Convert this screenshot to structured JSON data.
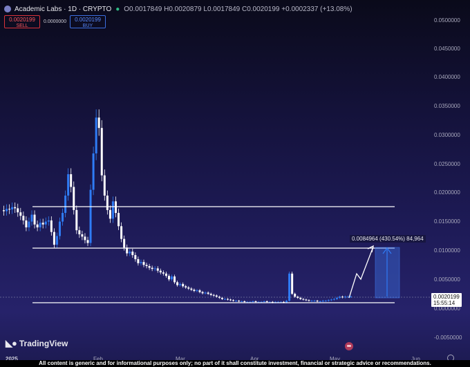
{
  "header": {
    "symbol": "Academic Labs · 1D · CRYPTO",
    "ohlc": "O0.0017849 H0.0020879 L0.0017849 C0.0020199 +0.0002337 (+13.08%)"
  },
  "trade": {
    "sell_price": "0.0020199",
    "sell_label": "SELL",
    "spread": "0.0000000",
    "buy_price": "0.0020199",
    "buy_label": "BUY"
  },
  "yaxis": {
    "ticks": [
      "0.0500000",
      "0.0450000",
      "0.0400000",
      "0.0350000",
      "0.0300000",
      "0.0250000",
      "0.0200000",
      "0.0150000",
      "0.0100000",
      "0.0050000",
      "0.0000000",
      "-0.0050000"
    ],
    "current_price": "0.0020199",
    "countdown": "15:55:14"
  },
  "xaxis": {
    "ticks": [
      "2025",
      "Feb",
      "Mar",
      "Apr",
      "May",
      "Jun"
    ]
  },
  "projection": {
    "label": "0.0084964 (430.54%) 84,964"
  },
  "levels": {
    "resistance_upper": 0.0175,
    "resistance_lower": 0.0105,
    "support": -0.0008
  },
  "branding": {
    "name": "TradingView"
  },
  "disclaimer": "All content is generic and for informational purposes only; no part of it shall constitute investment, financial or strategic advice or recommendations.",
  "colors": {
    "up": "#2f7cf6",
    "down": "#ffffff",
    "sell": "#d9323a",
    "buy": "#3b6fe0",
    "background": "#1d1a55"
  },
  "chart_data": {
    "type": "candlestick",
    "x": [
      "Jan 1",
      "Jan 2",
      "Jan 3",
      "Jan 4",
      "Jan 5",
      "Jan 6",
      "Jan 7",
      "Jan 8",
      "Jan 9",
      "Jan 10",
      "Jan 11",
      "Jan 12",
      "Jan 13",
      "Jan 14",
      "Jan 15",
      "Jan 16",
      "Jan 17",
      "Jan 18",
      "Jan 19",
      "Jan 20",
      "Jan 21",
      "Jan 22",
      "Jan 23",
      "Jan 24",
      "Jan 25",
      "Jan 26",
      "Jan 27",
      "Jan 28",
      "Jan 29",
      "Jan 30",
      "Jan 31",
      "Feb 1",
      "Feb 2",
      "Feb 3",
      "Feb 4",
      "Feb 5",
      "Feb 6",
      "Feb 7",
      "Feb 8",
      "Feb 9",
      "Feb 10",
      "Feb 11",
      "Feb 12",
      "Feb 13",
      "Feb 14",
      "Feb 15",
      "Feb 16",
      "Feb 17",
      "Feb 18",
      "Feb 19",
      "Feb 20",
      "Feb 21",
      "Feb 22",
      "Feb 23",
      "Feb 24",
      "Feb 25",
      "Feb 26",
      "Feb 27",
      "Feb 28",
      "Mar 1",
      "Mar 2",
      "Mar 3",
      "Mar 4",
      "Mar 5",
      "Mar 6",
      "Mar 7",
      "Mar 8",
      "Mar 9",
      "Mar 10",
      "Mar 11",
      "Mar 12",
      "Mar 13",
      "Mar 14",
      "Mar 15",
      "Mar 16",
      "Mar 17",
      "Mar 18",
      "Mar 19",
      "Mar 20",
      "Mar 21",
      "Mar 22",
      "Mar 23",
      "Mar 24",
      "Mar 25",
      "Mar 26",
      "Mar 27",
      "Mar 28",
      "Mar 29",
      "Mar 30",
      "Mar 31",
      "Apr 1",
      "Apr 2",
      "Apr 3",
      "Apr 4",
      "Apr 5",
      "Apr 6",
      "Apr 7",
      "Apr 8",
      "Apr 9",
      "Apr 10",
      "Apr 11",
      "Apr 12",
      "Apr 13",
      "Apr 14",
      "Apr 15",
      "Apr 16",
      "Apr 17",
      "Apr 18",
      "Apr 19",
      "Apr 20",
      "Apr 21",
      "Apr 22",
      "Apr 23",
      "Apr 24",
      "Apr 25",
      "Apr 26",
      "Apr 27",
      "Apr 28",
      "Apr 29",
      "Apr 30",
      "May 1",
      "May 2",
      "May 3",
      "May 4",
      "May 5",
      "May 6"
    ],
    "close": [
      0.0168,
      0.0172,
      0.0171,
      0.0175,
      0.0173,
      0.0166,
      0.016,
      0.0152,
      0.014,
      0.015,
      0.0162,
      0.0145,
      0.014,
      0.0148,
      0.0145,
      0.015,
      0.0152,
      0.0132,
      0.011,
      0.0125,
      0.015,
      0.0165,
      0.0195,
      0.0232,
      0.021,
      0.017,
      0.0135,
      0.0128,
      0.0124,
      0.0118,
      0.0113,
      0.0205,
      0.0268,
      0.033,
      0.0312,
      0.023,
      0.0195,
      0.017,
      0.0155,
      0.0185,
      0.0165,
      0.0142,
      0.012,
      0.0105,
      0.0095,
      0.0098,
      0.0092,
      0.0085,
      0.0078,
      0.008,
      0.0075,
      0.0073,
      0.007,
      0.0068,
      0.0069,
      0.0065,
      0.0062,
      0.006,
      0.0056,
      0.005,
      0.0055,
      0.0045,
      0.004,
      0.0042,
      0.0038,
      0.0036,
      0.0034,
      0.0032,
      0.003,
      0.0031,
      0.0028,
      0.0026,
      0.0027,
      0.0025,
      0.0023,
      0.0022,
      0.002,
      0.0018,
      0.0016,
      0.0016,
      0.0015,
      0.0014,
      0.0013,
      0.0013,
      0.0012,
      0.0012,
      0.0011,
      0.0011,
      0.0011,
      0.0012,
      0.0011,
      0.0011,
      0.0011,
      0.0012,
      0.0011,
      0.0011,
      0.001,
      0.0011,
      0.0011,
      0.0011,
      0.001,
      0.0013,
      0.006,
      0.0025,
      0.002,
      0.0018,
      0.0016,
      0.0015,
      0.0014,
      0.0013,
      0.0013,
      0.0013,
      0.0012,
      0.0012,
      0.0013,
      0.0013,
      0.0014,
      0.0015,
      0.0016,
      0.0018,
      0.002,
      0.0019,
      0.002,
      0.002,
      0.0020199
    ],
    "projection_target": 0.0105,
    "projection_change": "430.54%"
  }
}
